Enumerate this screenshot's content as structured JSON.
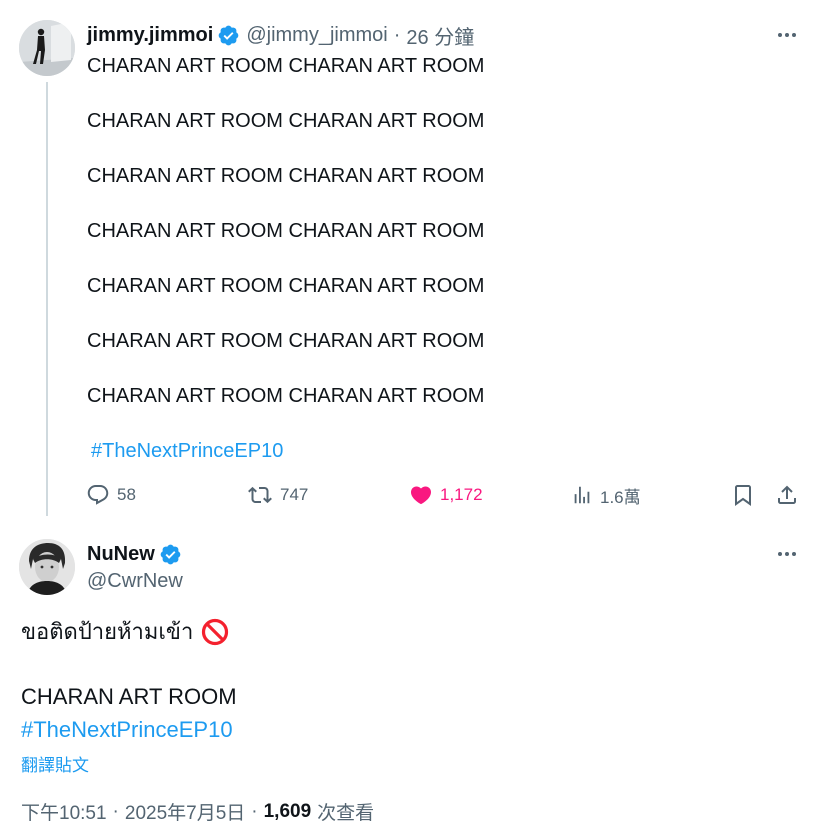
{
  "reply_tweet": {
    "display_name": "jimmy.jimmoi",
    "handle": "@jimmy_jimmoi",
    "separator": "·",
    "time": "26 分鐘",
    "verified": true,
    "lines": [
      "CHARAN ART ROOM CHARAN ART ROOM",
      "CHARAN ART ROOM CHARAN ART ROOM",
      "CHARAN ART ROOM CHARAN ART ROOM",
      "CHARAN ART ROOM CHARAN ART ROOM",
      "CHARAN ART ROOM CHARAN ART ROOM",
      "CHARAN ART ROOM CHARAN ART ROOM",
      "CHARAN ART ROOM CHARAN ART ROOM"
    ],
    "hashtag": "#TheNextPrinceEP10",
    "stats": {
      "replies": "58",
      "retweets": "747",
      "likes": "1,172",
      "views": "1.6萬"
    },
    "liked": true
  },
  "main_tweet": {
    "display_name": "NuNew",
    "handle": "@CwrNew",
    "verified": true,
    "text_line1": "ขอติดป้ายห้ามเข้า",
    "text_line2": "CHARAN ART ROOM",
    "hashtag": "#TheNextPrinceEP10",
    "translate_label": "翻譯貼文",
    "time": "下午10:51",
    "separator": "·",
    "date": "2025年7月5日",
    "views_count": "1,609",
    "views_label": "次查看"
  },
  "icons": {
    "verified": "verified-badge-icon",
    "more": "more-icon",
    "reply": "reply-icon",
    "retweet": "retweet-icon",
    "like": "heart-icon",
    "views": "views-icon",
    "bookmark": "bookmark-icon",
    "share": "share-icon",
    "no_entry": "no-entry-icon"
  },
  "colors": {
    "accent": "#1d9bf0",
    "like": "#f91880",
    "secondary_text": "#536471",
    "primary_text": "#0f1419",
    "thread_line": "#cfd9de"
  }
}
